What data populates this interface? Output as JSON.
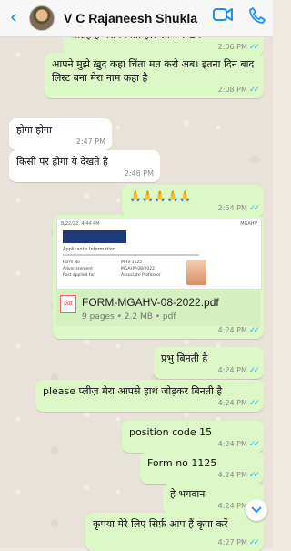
{
  "header": {
    "back_icon": "chevron-left-icon",
    "contact_name": "V C Rajaneesh Shukla",
    "video_icon": "video-call-icon",
    "phone_icon": "phone-icon",
    "accent": "#1e8ef0"
  },
  "messages": [
    {
      "dir": "out",
      "text": "आग्रह है मेरा बिनती है!! लाज रखिये",
      "time": "2:06 PM"
    },
    {
      "dir": "out",
      "text": "आपने मुझे ख़ुद कहा  चिंता मत करो अब। इतना दिन बाद लिस्ट बना  मेरा नाम कहा है",
      "time": "2:08 PM"
    },
    {
      "dir": "in",
      "text": "होगा होगा",
      "time": "2:47 PM"
    },
    {
      "dir": "in",
      "text": "किसी पर होगा ये देखते है",
      "time": "2:48 PM"
    },
    {
      "dir": "out",
      "text": "🙏🙏🙏🙏🙏",
      "time": "2:54 PM"
    },
    {
      "dir": "out",
      "type": "pdf",
      "file_name": "FORM-MGAHV-08-2022.pdf",
      "meta": "9 pages • 2.2 MB • pdf",
      "badge": "pdf",
      "time": "4:24 PM",
      "preview": {
        "date": "8/22/22, 4:44 PM",
        "org": "MGAHV",
        "heading": "Applicant's Information",
        "rows": [
          "Form No",
          "Advertisement",
          "Post applied for"
        ],
        "values": [
          "MHV-1125",
          "MGAHV-08/2022",
          "Associate Professor"
        ]
      }
    },
    {
      "dir": "out",
      "text": "प्रभु बिनती है",
      "time": "4:24 PM"
    },
    {
      "dir": "out",
      "text": "please प्लीज़ मेरा आपसे हाथ जोड़कर बिनती है",
      "time": "4:24 PM"
    },
    {
      "dir": "out",
      "text": "position code 15",
      "time": "4:24 PM"
    },
    {
      "dir": "out",
      "text": "Form no  1125",
      "time": "4:24 PM"
    },
    {
      "dir": "out",
      "text": "हे भगवान",
      "time": "4:24 PM"
    },
    {
      "dir": "out",
      "text": "कृपया मेरे लिए सिर्फ़ आप हैं कृपा करें",
      "time": "4:27 PM"
    }
  ],
  "ui": {
    "scroll_down_icon": "chevron-down-icon",
    "read_ticks": "✓✓"
  }
}
